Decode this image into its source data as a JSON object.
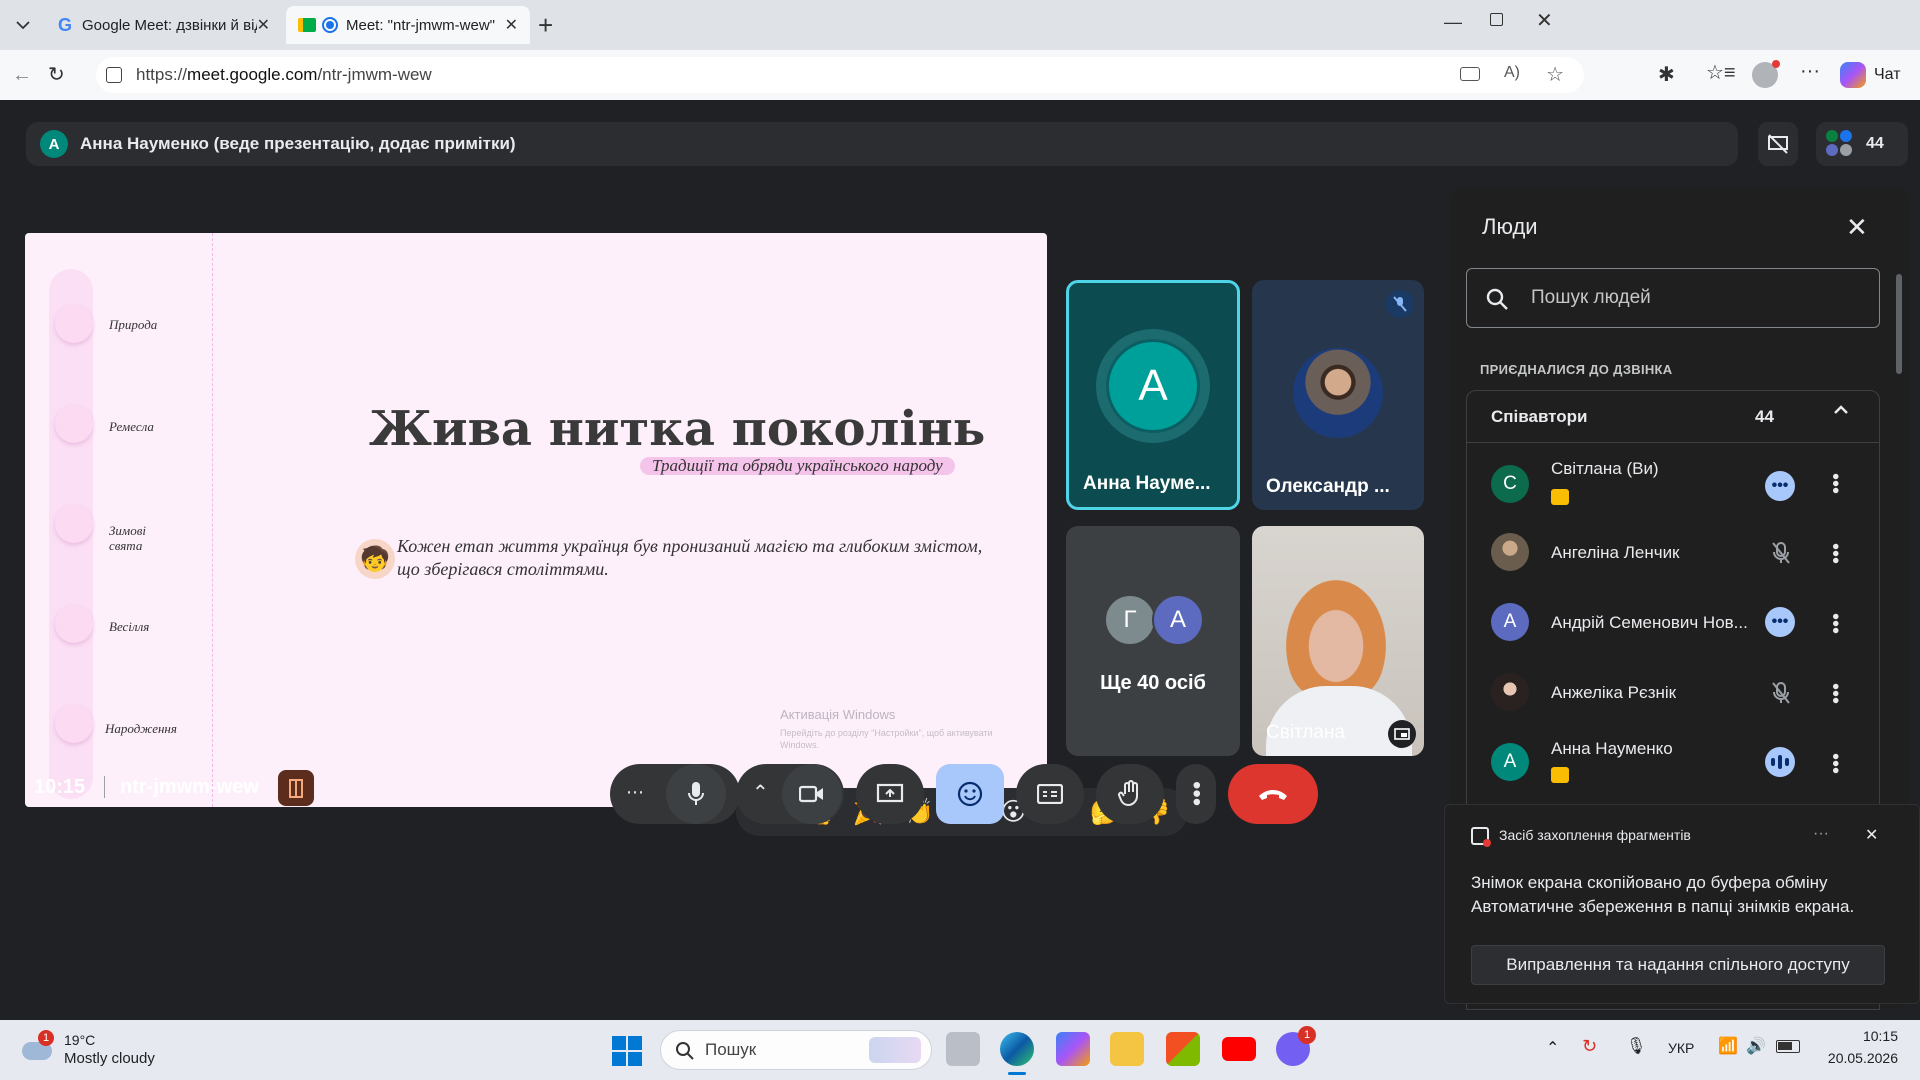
{
  "browser": {
    "tabs": [
      {
        "title": "Google Meet: дзвінки й відеоконф",
        "active": false
      },
      {
        "title": "Meet: \"ntr-jmwm-wew\"",
        "active": true
      }
    ],
    "url_prefix": "https://",
    "url_host": "meet.google.com",
    "url_path": "/ntr-jmwm-wew",
    "chat_label": "Чат"
  },
  "meet": {
    "presenter_initial": "A",
    "presenter_text": "Анна Науменко (веде презентацію, додає примітки)",
    "participant_count": "44",
    "clock": "10:15",
    "meeting_code": "ntr-jmwm-wew",
    "slide": {
      "title": "Жива нитка поколінь",
      "subtitle": "Традиції та обряди українського народу",
      "body": "Кожен етап життя українця був пронизаний магією та глибоким змістом, що зберігався століттями.",
      "nav": [
        "Природа",
        "Ремесла",
        "Зимові свята",
        "Весілля",
        "Народження"
      ],
      "watermark_title": "Активація Windows",
      "watermark_text": "Перейдіть до розділу \"Настройки\", щоб активувати Windows."
    },
    "tiles": [
      {
        "name": "Анна Науме...",
        "initial": "A"
      },
      {
        "name": "Олександр ..."
      },
      {
        "name": "Ще 40 осіб",
        "initials": [
          "Г",
          "А"
        ]
      },
      {
        "name": "Світлана"
      }
    ],
    "reactions": [
      "💖",
      "👍",
      "🎉",
      "👏",
      "😂",
      "😮",
      "😢",
      "🤔",
      "👎"
    ]
  },
  "people_panel": {
    "title": "Люди",
    "search_placeholder": "Пошук людей",
    "section_label": "ПРИЄДНАЛИСЯ ДО ДЗВІНКА",
    "group_name": "Співавтори",
    "group_count": "44",
    "people": [
      {
        "name": "Світлана (Ви)",
        "initial": "С",
        "color": "#0b6b4c",
        "status": "more"
      },
      {
        "name": "Ангеліна Ленчик",
        "initial": "",
        "color": "#6b5d4e",
        "status": "muted"
      },
      {
        "name": "Андрій Семенович Нов...",
        "initial": "А",
        "color": "#5c6bc0",
        "status": "more"
      },
      {
        "name": "Анжеліка Рєзнік",
        "initial": "",
        "color": "#3e3530",
        "status": "muted"
      },
      {
        "name": "Анна Науменко",
        "initial": "А",
        "color": "#00897b",
        "status": "speaking"
      }
    ]
  },
  "toast": {
    "app_name": "Засіб захоплення фрагментів",
    "line1": "Знімок екрана скопійовано до буфера обміну",
    "line2": "Автоматичне збереження в папці знімків екрана.",
    "button": "Виправлення та надання спільного доступу"
  },
  "taskbar": {
    "weather_temp": "19°C",
    "weather_desc": "Mostly cloudy",
    "weather_badge": "1",
    "search_placeholder": "Пошук",
    "viber_badge": "1",
    "lang": "УКР",
    "time": "10:15",
    "date": "20.05.2026"
  }
}
